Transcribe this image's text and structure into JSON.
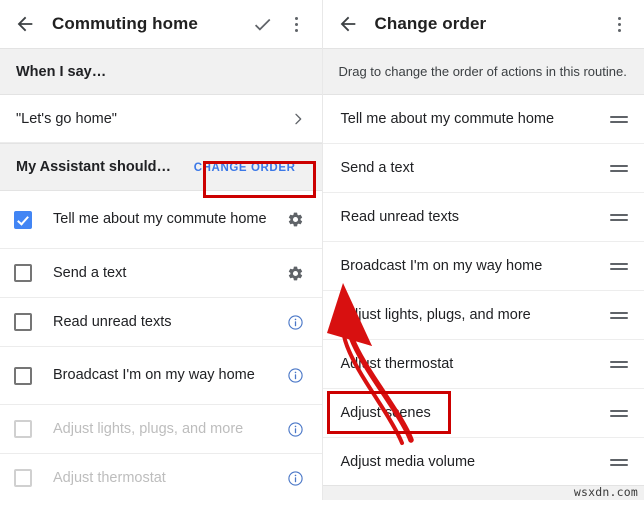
{
  "left_screen": {
    "appbar": {
      "back_icon": "arrow-back-icon",
      "title": "Commuting home",
      "confirm_icon": "check-icon",
      "overflow_icon": "more-vert-icon"
    },
    "when_i_say": {
      "section_label": "When I say…",
      "phrase": "\"Let's go home\"",
      "chevron_icon": "chevron-right-icon"
    },
    "assistant_should": {
      "section_label": "My Assistant should…",
      "change_order_label": "CHANGE ORDER",
      "highlight_color": "#cc0000",
      "link_color": "#3b78e7"
    },
    "actions": [
      {
        "label": "Tell me about my commute home",
        "checked": true,
        "enabled": true,
        "trailing_icon": "gear-icon",
        "two_line": true
      },
      {
        "label": "Send a text",
        "checked": false,
        "enabled": true,
        "trailing_icon": "gear-icon",
        "two_line": false
      },
      {
        "label": "Read unread texts",
        "checked": false,
        "enabled": true,
        "trailing_icon": "info-icon",
        "two_line": false
      },
      {
        "label": "Broadcast I'm on my way home",
        "checked": false,
        "enabled": true,
        "trailing_icon": "info-icon",
        "two_line": true
      },
      {
        "label": "Adjust lights, plugs, and more",
        "checked": false,
        "enabled": false,
        "trailing_icon": "info-icon",
        "two_line": false
      },
      {
        "label": "Adjust thermostat",
        "checked": false,
        "enabled": false,
        "trailing_icon": "info-icon",
        "two_line": false
      }
    ]
  },
  "right_screen": {
    "appbar": {
      "back_icon": "arrow-back-icon",
      "title": "Change order",
      "overflow_icon": "more-vert-icon"
    },
    "hint": "Drag to change the order of actions in this routine.",
    "order_items": [
      {
        "label": "Tell me about my commute home",
        "drag_icon": "drag-handle-icon",
        "highlighted": false
      },
      {
        "label": "Send a text",
        "drag_icon": "drag-handle-icon",
        "highlighted": false
      },
      {
        "label": "Read unread texts",
        "drag_icon": "drag-handle-icon",
        "highlighted": false
      },
      {
        "label": "Broadcast I'm on my way home",
        "drag_icon": "drag-handle-icon",
        "highlighted": false
      },
      {
        "label": "Adjust lights, plugs, and more",
        "drag_icon": "drag-handle-icon",
        "highlighted": false
      },
      {
        "label": "Adjust thermostat",
        "drag_icon": "drag-handle-icon",
        "highlighted": false
      },
      {
        "label": "Adjust scenes",
        "drag_icon": "drag-handle-icon",
        "highlighted": true
      },
      {
        "label": "Adjust media volume",
        "drag_icon": "drag-handle-icon",
        "highlighted": false
      }
    ]
  },
  "annotations": {
    "arrow_icon": "red-arrow-annotation",
    "arrow_color": "#d81010",
    "watermark": "wsxdn.com"
  }
}
